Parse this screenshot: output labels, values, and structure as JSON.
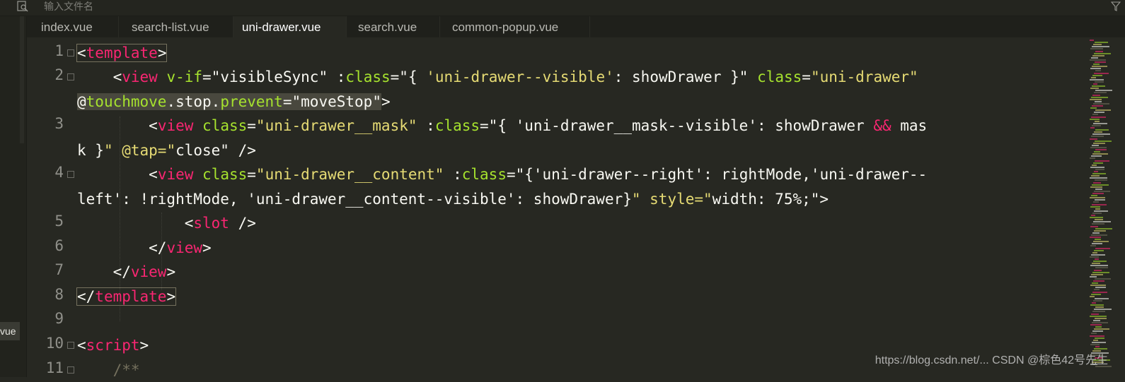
{
  "search": {
    "placeholder": "输入文件名"
  },
  "sidebar": {
    "file_label": "vue"
  },
  "tabs": [
    {
      "label": "index.vue",
      "active": false
    },
    {
      "label": "search-list.vue",
      "active": false
    },
    {
      "label": "uni-drawer.vue",
      "active": true
    },
    {
      "label": "search.vue",
      "active": false
    },
    {
      "label": "common-popup.vue",
      "active": false
    }
  ],
  "editor": {
    "line_numbers": [
      "1",
      "2",
      "3",
      "4",
      "5",
      "6",
      "7",
      "8",
      "9",
      "10",
      "11"
    ],
    "code_lines": [
      "<template>",
      "<view v-if=\"visibleSync\" :class=\"{ 'uni-drawer--visible': showDrawer }\" class=\"uni-drawer\" @touchmove.stop.prevent=\"moveStop\">",
      "<view class=\"uni-drawer__mask\" :class=\"{ 'uni-drawer__mask--visible': showDrawer && mask }\" @tap=\"close\" />",
      "<view class=\"uni-drawer__content\" :class=\"{'uni-drawer--right': rightMode,'uni-drawer--left': !rightMode, 'uni-drawer__content--visible': showDrawer}\" style=\"width: 75%;\">",
      "<slot />",
      "</view>",
      "</view>",
      "</template>",
      "",
      "<script>",
      "/**"
    ]
  },
  "colors": {
    "background": "#272822",
    "tag": "#f92672",
    "attribute": "#a6e22e",
    "string": "#e6db74",
    "text": "#f8f8f2"
  },
  "watermark": "https://blog.csdn.net/... CSDN @棕色42号先生"
}
